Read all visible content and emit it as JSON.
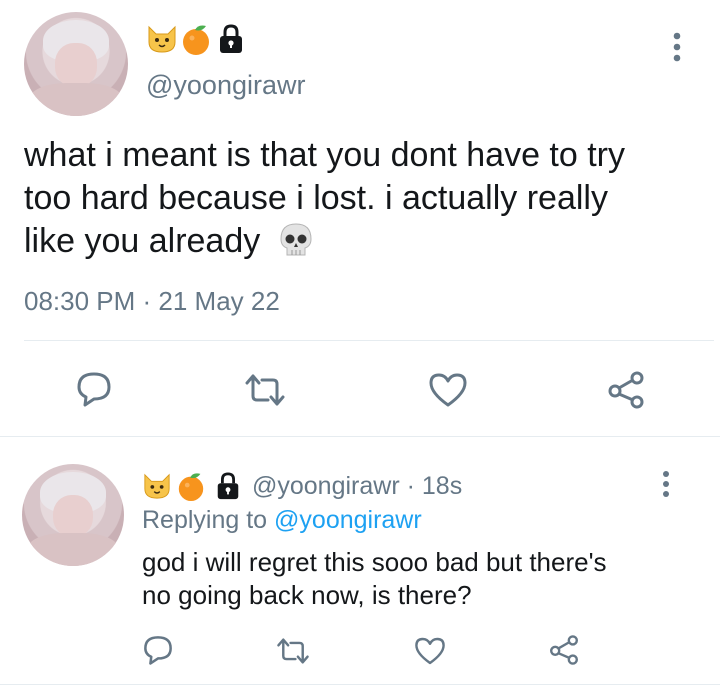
{
  "main_tweet": {
    "handle_emojis": [
      "cat-face",
      "tangerine",
      "lock"
    ],
    "handle": "@yoongirawr",
    "text_lines": [
      "what i meant is that you dont have to try",
      "too hard because i lost. i actually really",
      "like you already"
    ],
    "text_emoji": "skull",
    "timestamp": "08:30 PM · 21 May 22"
  },
  "reply_tweet": {
    "handle": "@yoongirawr",
    "time_sep": "·",
    "time": "18s",
    "replying_label": "Replying to",
    "replying_to": "@yoongirawr",
    "text_lines": [
      "god i will regret this sooo bad but there's",
      "no going back now, is there?"
    ]
  },
  "actions": [
    "reply",
    "retweet",
    "like",
    "share"
  ],
  "colors": {
    "text": "#14171a",
    "secondary": "#657786",
    "link": "#1da1f2",
    "divider": "#e6ecf0"
  }
}
